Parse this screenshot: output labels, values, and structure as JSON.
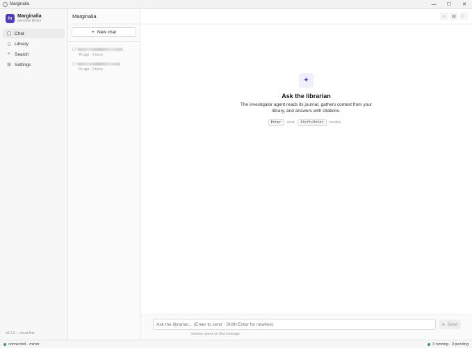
{
  "window": {
    "title": "Marginalia",
    "controls": [
      "—",
      "☐",
      "✕"
    ]
  },
  "brand": {
    "logo": "ln",
    "name": "Marginalia",
    "subtitle": "personal library"
  },
  "sidebar": {
    "items": [
      {
        "label": "Chat",
        "icon": "chat-icon",
        "glyph": "▢",
        "active": true
      },
      {
        "label": "Library",
        "icon": "book-icon",
        "glyph": "▯",
        "active": false
      },
      {
        "label": "Search",
        "icon": "search-icon",
        "glyph": "⌕",
        "active": false
      },
      {
        "label": "Settings",
        "icon": "gear-icon",
        "glyph": "⚙",
        "active": false
      }
    ],
    "footer": "v0.1.0 — local-first"
  },
  "header": {
    "title": "Marginalia",
    "tools": [
      "☼",
      "▤",
      "☾"
    ]
  },
  "chatlist": {
    "new_chat_label": "New chat",
    "items": [
      {
        "meta": "4h ago · 0 turns"
      },
      {
        "meta": "5h ago · 0 turns"
      }
    ]
  },
  "empty_state": {
    "icon": "sparkles-icon",
    "icon_glyph": "✦",
    "title": "Ask the librarian",
    "description": "The investigator agent reads its journal, gathers context from your library, and answers with citations.",
    "hint_send_key": "Enter",
    "hint_send": "send",
    "hint_newline_key": "Shift+Enter",
    "hint_newline": "newline"
  },
  "composer": {
    "placeholder": "Ask the librarian... (Enter to send · Shift+Enter for newline)",
    "send_label": "Send",
    "send_glyph": "➤",
    "note": "session opens on first message"
  },
  "status": {
    "left": "connected · mirror",
    "right": "3 running · 0 pending",
    "accent": "#2e9e4f"
  }
}
